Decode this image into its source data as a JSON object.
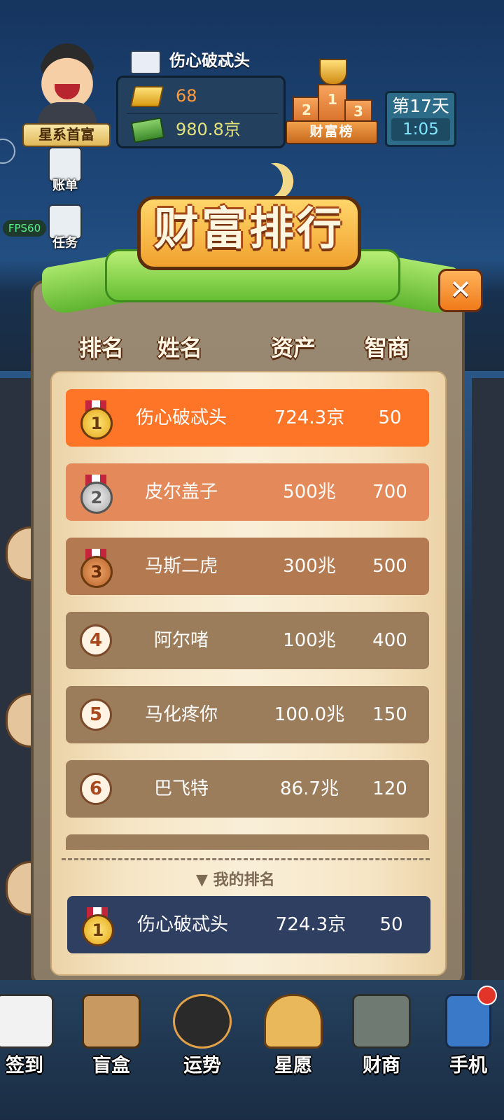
{
  "hud": {
    "avatar_title": "星系首富",
    "player_name": "伤心破忒头",
    "gold": "68",
    "cash": "980.8京",
    "leaderboard_label": "财富榜",
    "podium": [
      "2",
      "1",
      "3"
    ],
    "day": "第17天",
    "time": "1:05",
    "side_buttons": [
      {
        "label": "账单",
        "icon": "bill-icon"
      },
      {
        "label": "任务",
        "icon": "task-icon"
      }
    ],
    "fps": "FPS60"
  },
  "panel": {
    "title": "财富排行",
    "columns": [
      "排名",
      "姓名",
      "资产",
      "智商"
    ],
    "rows": [
      {
        "rank": "1",
        "name": "伤心破忒头",
        "asset": "724.3京",
        "iq": "50"
      },
      {
        "rank": "2",
        "name": "皮尔盖子",
        "asset": "500兆",
        "iq": "700"
      },
      {
        "rank": "3",
        "name": "马斯二虎",
        "asset": "300兆",
        "iq": "500"
      },
      {
        "rank": "4",
        "name": "阿尔啫",
        "asset": "100兆",
        "iq": "400"
      },
      {
        "rank": "5",
        "name": "马化疼你",
        "asset": "100.0兆",
        "iq": "150"
      },
      {
        "rank": "6",
        "name": "巴飞特",
        "asset": "86.7兆",
        "iq": "120"
      }
    ],
    "my_rank_label": "我的排名",
    "my_rank": {
      "rank": "1",
      "name": "伤心破忒头",
      "asset": "724.3京",
      "iq": "50"
    },
    "close_symbol": "✕"
  },
  "bottom_nav": [
    {
      "label": "签到",
      "icon": "checkin-icon",
      "color": "#f2f2f2"
    },
    {
      "label": "盲盒",
      "icon": "blindbox-icon",
      "color": "#c89a62"
    },
    {
      "label": "运势",
      "icon": "fortune-icon",
      "color": "#2a2a2a"
    },
    {
      "label": "星愿",
      "icon": "wish-tree-icon",
      "color": "#e8b85a"
    },
    {
      "label": "财商",
      "icon": "card-icon",
      "color": "#6f7a72"
    },
    {
      "label": "手机",
      "icon": "phone-icon",
      "color": "#3a78c8"
    }
  ]
}
